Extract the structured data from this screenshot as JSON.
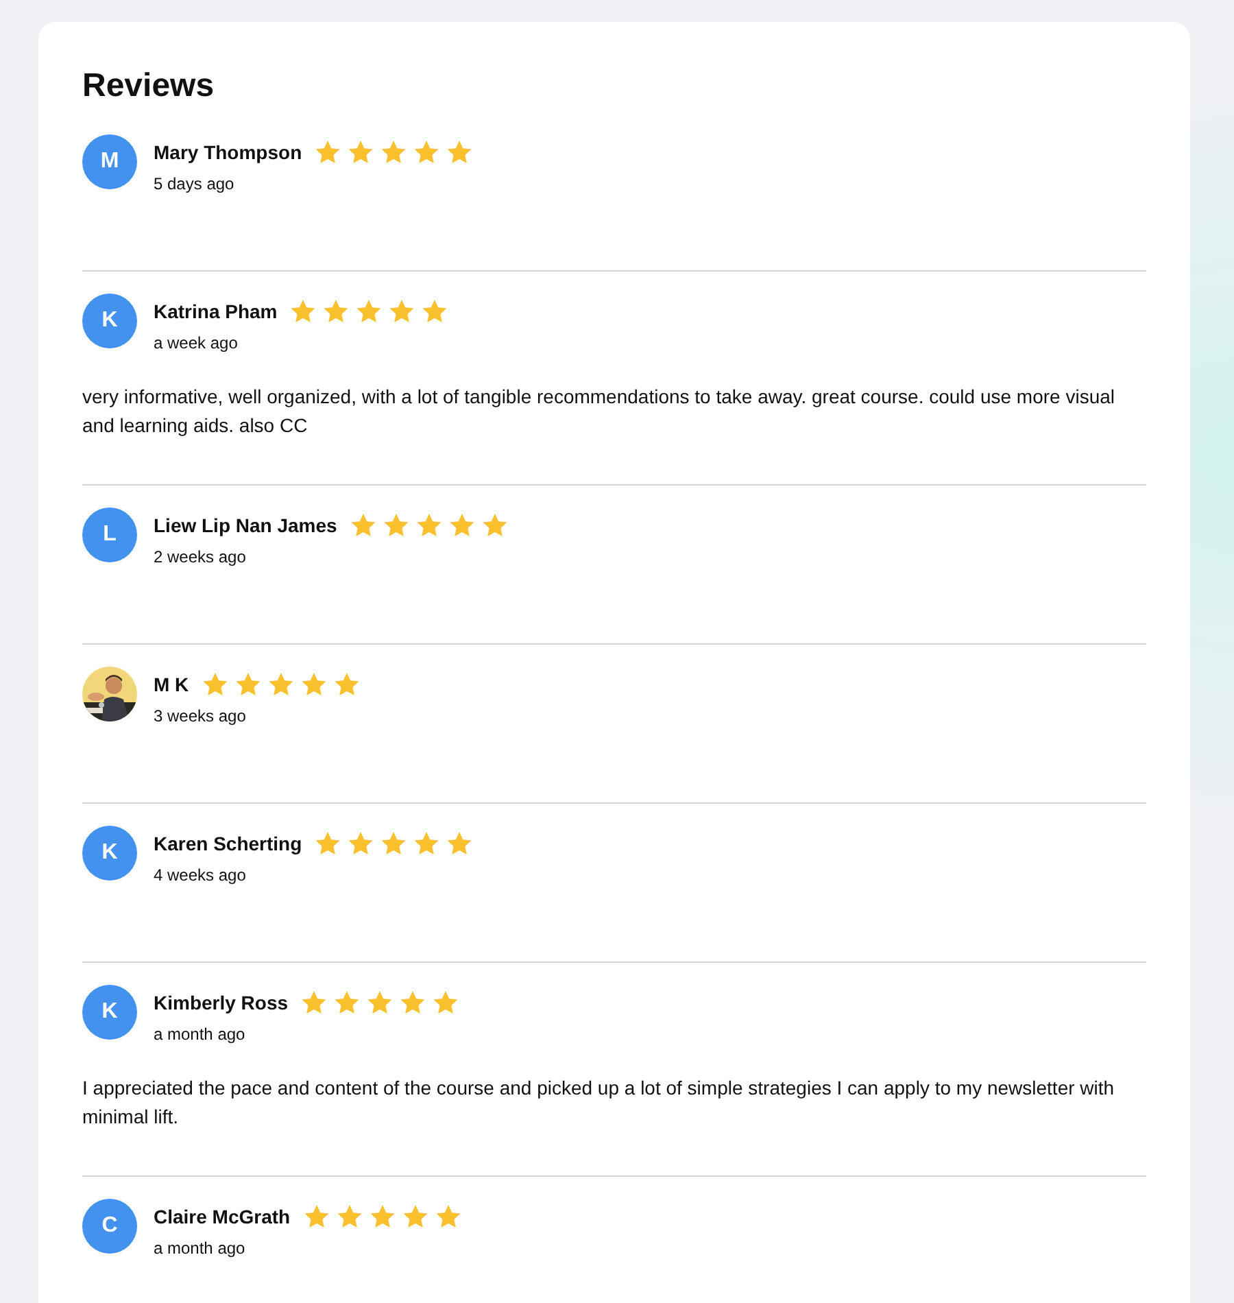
{
  "title": "Reviews",
  "reviews": [
    {
      "avatar": {
        "kind": "letter",
        "letter": "M"
      },
      "name": "Mary Thompson",
      "stars": 5,
      "time": "5 days ago"
    },
    {
      "avatar": {
        "kind": "letter",
        "letter": "K"
      },
      "name": "Katrina Pham",
      "stars": 5,
      "time": "a week ago",
      "comment": "very informative, well organized, with a lot of tangible recommendations to take away. great course. could use more visual and learning aids. also CC"
    },
    {
      "avatar": {
        "kind": "letter",
        "letter": "L"
      },
      "name": "Liew Lip Nan James",
      "stars": 5,
      "time": "2 weeks ago"
    },
    {
      "name": "M K",
      "stars": 5,
      "time": "3 weeks ago"
    },
    {
      "avatar": {
        "kind": "letter",
        "letter": "K"
      },
      "name": "Karen Scherting",
      "stars": 5,
      "time": "4 weeks ago"
    },
    {
      "avatar": {
        "kind": "letter",
        "letter": "K"
      },
      "name": "Kimberly Ross",
      "stars": 5,
      "time": "a month ago",
      "comment": "I appreciated the pace and content of the course and picked up a lot of simple strategies I can apply to my newsletter with minimal lift."
    },
    {
      "avatar": {
        "kind": "letter",
        "letter": "C"
      },
      "name": "Claire McGrath",
      "stars": 5,
      "time": "a month ago"
    }
  ]
}
